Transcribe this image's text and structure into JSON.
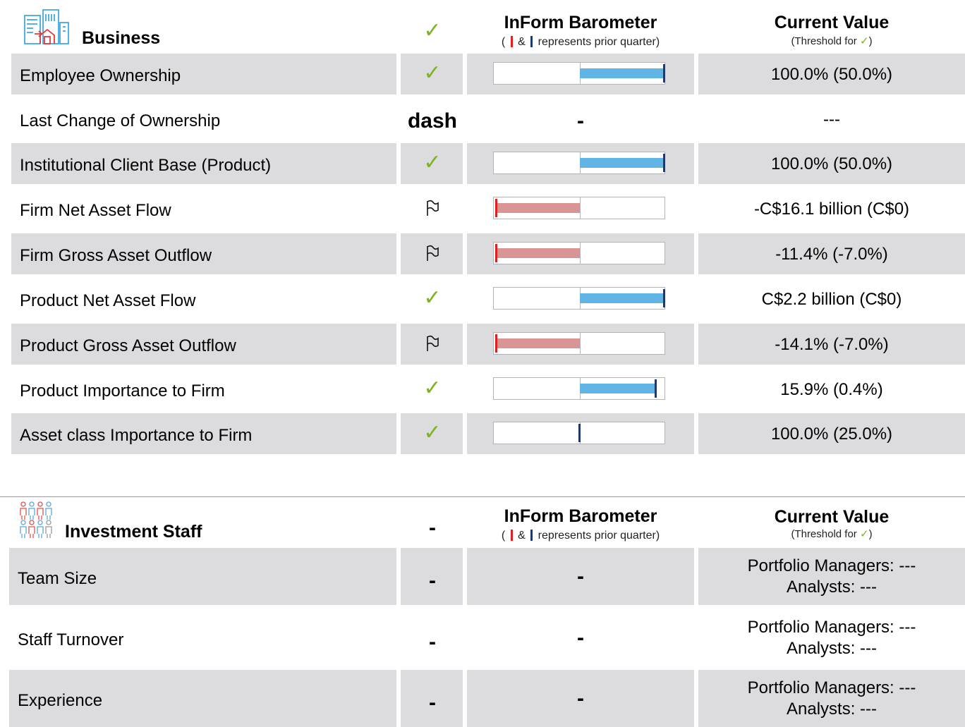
{
  "business": {
    "title": "Business",
    "status": "check",
    "barometer_title": "InForm Barometer",
    "barometer_sub_open": "(",
    "barometer_sub_amp": "&",
    "barometer_sub_rest": "represents prior quarter)",
    "value_title": "Current Value",
    "value_sub_pre": "(Threshold for",
    "value_sub_post": ")",
    "rows": [
      {
        "label": "Employee Ownership",
        "status": "check",
        "fill_fraction": 1.0,
        "direction": "positive",
        "value": "100.0% (50.0%)"
      },
      {
        "label": "Last Change of Ownership",
        "status": "dash",
        "barometer": "-",
        "value": "---"
      },
      {
        "label": "Institutional Client Base (Product)",
        "status": "check",
        "fill_fraction": 1.0,
        "direction": "positive",
        "value": "100.0% (50.0%)"
      },
      {
        "label": "Firm Net Asset Flow",
        "status": "flag",
        "fill_fraction": 1.0,
        "direction": "negative",
        "value": "-C$16.1 billion (C$0)"
      },
      {
        "label": "Firm Gross Asset Outflow",
        "status": "flag",
        "fill_fraction": 1.0,
        "direction": "negative",
        "value": "-11.4% (-7.0%)"
      },
      {
        "label": "Product Net Asset Flow",
        "status": "check",
        "fill_fraction": 1.0,
        "direction": "positive",
        "value": "C$2.2 billion (C$0)"
      },
      {
        "label": "Product Gross Asset Outflow",
        "status": "flag",
        "fill_fraction": 1.0,
        "direction": "negative",
        "value": "-14.1% (-7.0%)"
      },
      {
        "label": "Product Importance to Firm",
        "status": "check",
        "fill_fraction": 0.9,
        "direction": "positive",
        "value": "15.9% (0.4%)"
      },
      {
        "label": "Asset class Importance to Firm",
        "status": "check",
        "fill_fraction": 0.0,
        "direction": "positive",
        "value": "100.0% (25.0%)"
      }
    ]
  },
  "investment_staff": {
    "title": "Investment Staff",
    "status": "-",
    "barometer_title": "InForm Barometer",
    "barometer_sub_open": "(",
    "barometer_sub_amp": "&",
    "barometer_sub_rest": "represents prior quarter)",
    "value_title": "Current Value",
    "value_sub_pre": "(Threshold for",
    "value_sub_post": ")",
    "rows": [
      {
        "label": "Team Size",
        "status": "-",
        "barometer": "-",
        "value_line1": "Portfolio Managers: ---",
        "value_line2": "Analysts: ---"
      },
      {
        "label": "Staff Turnover",
        "status": "-",
        "barometer": "-",
        "value_line1": "Portfolio Managers: ---",
        "value_line2": "Analysts: ---"
      },
      {
        "label": "Experience",
        "status": "-",
        "barometer": "-",
        "value_line1": "Portfolio Managers: ---",
        "value_line2": "Analysts: ---"
      }
    ]
  },
  "colors": {
    "band": "#dcdcde",
    "check": "#7ab51d",
    "positive_fill": "#61b5e4",
    "negative_fill": "#d99494",
    "prior_navy": "#1f3a6a",
    "prior_red": "#e02020"
  },
  "icons": {
    "business": "buildings-icon",
    "staff": "people-icon",
    "status_check": "check-icon",
    "status_flag": "flag-icon"
  }
}
